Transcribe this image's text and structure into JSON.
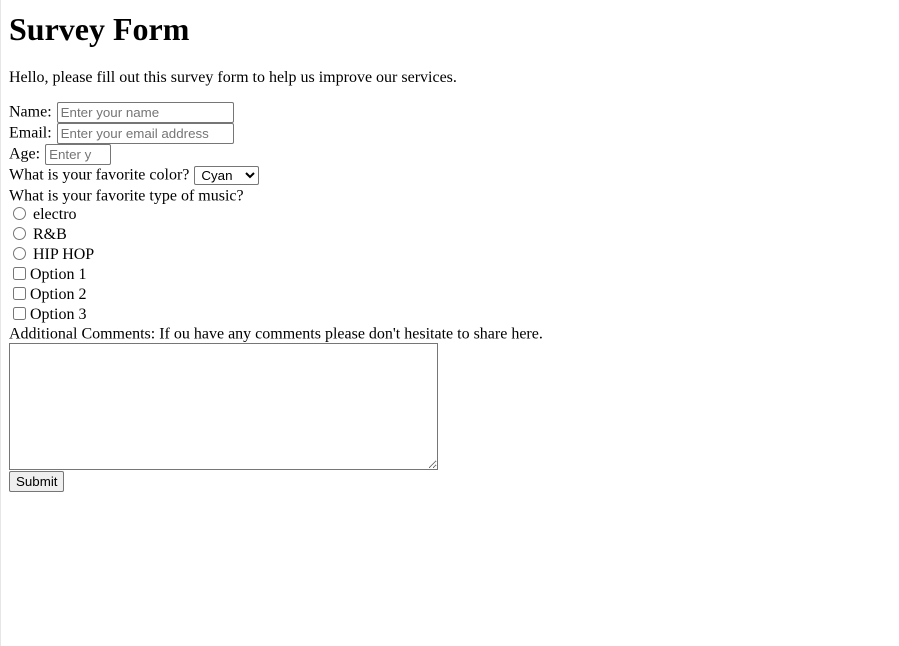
{
  "page": {
    "title": "Survey Form",
    "description": "Hello, please fill out this survey form to help us improve our services."
  },
  "form": {
    "name_label": "Name:",
    "name_placeholder": "Enter your name",
    "email_label": "Email:",
    "email_placeholder": "Enter your email address",
    "age_label": "Age:",
    "age_placeholder": "Enter y",
    "color_label": "What is your favorite color?",
    "color_selected": "Cyan",
    "music_label": "What is your favorite type of music?",
    "music_options": [
      "electro",
      "R&B",
      "HIP HOP"
    ],
    "checkbox_options": [
      "Option 1",
      "Option 2",
      "Option 3"
    ],
    "comments_label": "Additional Comments: If ou have any comments please don't hesitate to share here.",
    "submit_label": "Submit"
  }
}
